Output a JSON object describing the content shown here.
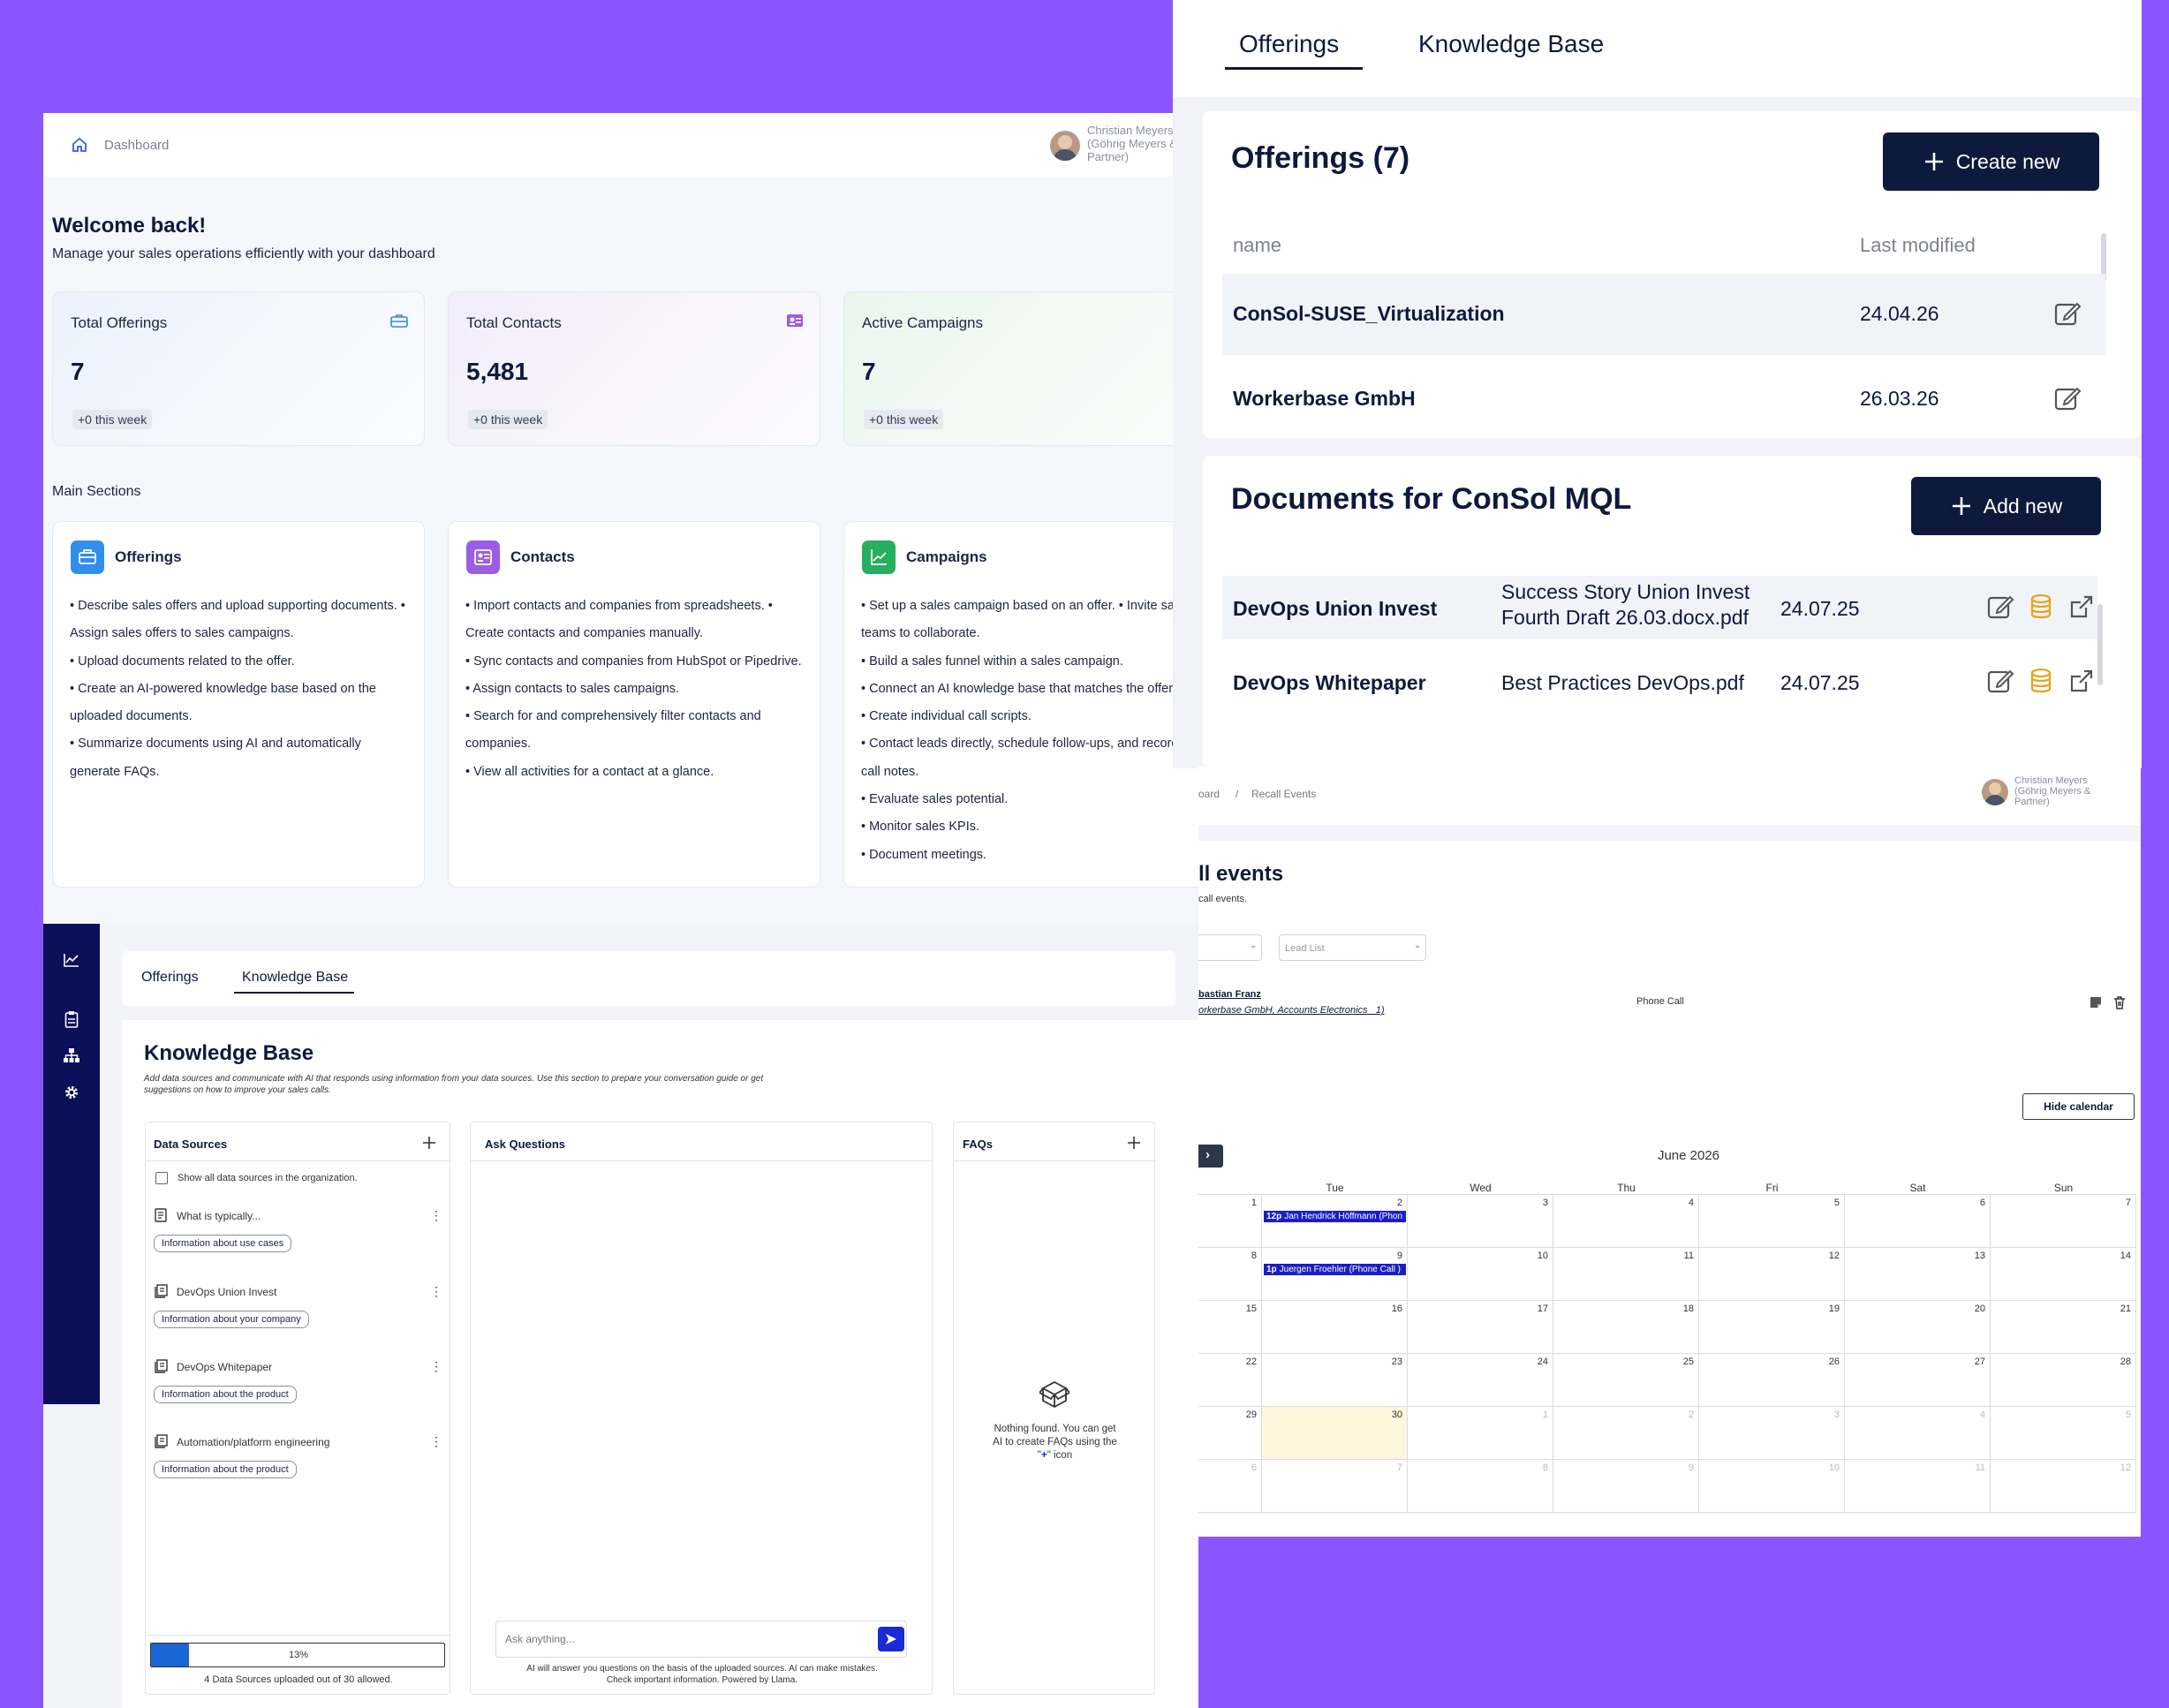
{
  "dashboard": {
    "breadcrumb": "Dashboard",
    "user": {
      "name_line1": "Christian Meyers",
      "name_line2": "(Göhrig Meyers &",
      "name_line3": "Partner)"
    },
    "welcome_title": "Welcome back!",
    "welcome_sub": "Manage your sales operations efficiently with your dashboard",
    "stats": [
      {
        "label": "Total Offerings",
        "value": "7",
        "delta": "+0 this week",
        "icon": "briefcase-icon",
        "color": "#3a86d8"
      },
      {
        "label": "Total Contacts",
        "value": "5,481",
        "delta": "+0 this week",
        "icon": "contact-card-icon",
        "color": "#9b5de5"
      },
      {
        "label": "Active Campaigns",
        "value": "7",
        "delta": "+0 this week",
        "icon": "trend-chart-icon",
        "color": "#2fa84f"
      }
    ],
    "main_sections_title": "Main Sections",
    "sections": [
      {
        "title": "Offerings",
        "icon": "briefcase-icon",
        "color": "#2f8fea",
        "lines": [
          "• Describe sales offers and upload supporting documents. •",
          "Assign sales offers to sales campaigns.",
          "• Upload documents related to the offer.",
          "• Create an AI-powered knowledge base based on the",
          "uploaded documents.",
          "• Summarize documents using AI and automatically",
          "generate FAQs."
        ]
      },
      {
        "title": "Contacts",
        "icon": "contact-card-icon",
        "color": "#9b5de5",
        "lines": [
          "• Import contacts and companies from spreadsheets. •",
          "Create contacts and companies manually.",
          "• Sync contacts and companies from HubSpot or Pipedrive.",
          "• Assign contacts to sales campaigns.",
          "• Search for and comprehensively filter contacts and",
          "companies.",
          "• View all activities for a contact at a glance."
        ]
      },
      {
        "title": "Campaigns",
        "icon": "trend-chart-icon",
        "color": "#27ae60",
        "lines": [
          "• Set up a sales campaign based on an offer. • Invite sales",
          "teams to collaborate.",
          "• Build a sales funnel within a sales campaign.",
          "• Connect an AI knowledge base that matches the offer.",
          "• Create individual call scripts.",
          "• Contact leads directly, schedule follow-ups, and record",
          "call notes.",
          "• Evaluate sales potential.",
          "• Monitor sales KPIs.",
          "• Document meetings."
        ]
      }
    ]
  },
  "offerings_panel": {
    "tabs": [
      "Offerings",
      "Knowledge Base"
    ],
    "title": "Offerings (7)",
    "create_btn": "Create new",
    "col_name": "name",
    "col_modified": "Last modified",
    "rows": [
      {
        "name": "ConSol-SUSE_Virtualization",
        "modified": "24.04.26"
      },
      {
        "name": "Workerbase GmbH",
        "modified": "26.03.26"
      }
    ],
    "docs_title": "Documents for ConSol MQL",
    "add_btn": "Add new",
    "docs": [
      {
        "name": "DevOps Union Invest",
        "file1": "Success Story Union Invest",
        "file2": "Fourth Draft 26.03.docx.pdf",
        "date": "24.07.25"
      },
      {
        "name": "DevOps Whitepaper",
        "file1": "Best Practices DevOps.pdf",
        "file2": "",
        "date": "24.07.25"
      }
    ]
  },
  "kb_panel": {
    "tabs": [
      "Offerings",
      "Knowledge Base"
    ],
    "title": "Knowledge Base",
    "desc_line1": "Add data sources and communicate with AI that responds using information from your data sources. Use this section to prepare your conversation guide or get",
    "desc_line2": "suggestions on how to improve your sales calls.",
    "data_sources_title": "Data Sources",
    "show_all_label": "Show all data sources in the organization.",
    "sources": [
      {
        "name": "What is typically...",
        "tag": "Information about use cases",
        "icon": "document-icon"
      },
      {
        "name": "DevOps Union Invest",
        "tag": "Information about your company",
        "icon": "file-stack-icon"
      },
      {
        "name": "DevOps Whitepaper",
        "tag": "Information about the product",
        "icon": "file-stack-icon"
      },
      {
        "name": "Automation/platform engineering",
        "tag": "Information about the product",
        "icon": "file-stack-icon"
      }
    ],
    "progress": 0.13,
    "progress_label": "13%",
    "upload_caption": "4 Data Sources uploaded out of 30 allowed.",
    "ask_title": "Ask Questions",
    "ask_placeholder": "Ask anything...",
    "ai_note_line1": "AI will answer you questions on the basis of the uploaded sources. AI can make mistakes.",
    "ai_note_line2": "Check important information. Powered by Llama.",
    "faqs_title": "FAQs",
    "faq_empty_line1": "Nothing found. You can get",
    "faq_empty_line2": "AI to create FAQs using the",
    "faq_empty_line3_pre": "\"",
    "faq_empty_line3_post": "\" icon"
  },
  "recall_panel": {
    "breadcrumb_prev": "oard",
    "breadcrumb_sep": "/",
    "breadcrumb_current": "Recall Events",
    "user": {
      "name_line1": "Christian Meyers",
      "name_line2": "(Göhrig Meyers &",
      "name_line3": "Partner)"
    },
    "title": "ll events",
    "subtitle": "call events.",
    "filter2_placeholder": "Lead List",
    "event": {
      "name": "bastian Franz",
      "company": "orkerbase GmbH, Accounts Electronics _1)",
      "type": "Phone Call"
    },
    "hide_calendar_btn": "Hide calendar",
    "month_label": "June 2026",
    "weekdays": [
      "",
      "Tue",
      "Wed",
      "Thu",
      "Fri",
      "Sat",
      "Sun"
    ],
    "weeks": [
      [
        "1",
        "2",
        "3",
        "4",
        "5",
        "6",
        "7"
      ],
      [
        "8",
        "9",
        "10",
        "11",
        "12",
        "13",
        "14"
      ],
      [
        "15",
        "16",
        "17",
        "18",
        "19",
        "20",
        "21"
      ],
      [
        "22",
        "23",
        "24",
        "25",
        "26",
        "27",
        "28"
      ],
      [
        "29",
        "30",
        "1",
        "2",
        "3",
        "4",
        "5"
      ],
      [
        "6",
        "7",
        "8",
        "9",
        "10",
        "11",
        "12"
      ]
    ],
    "calendar_events": [
      {
        "week": 0,
        "day": 1,
        "time": "12p",
        "label": "Jan Hendrick Höffmann (Phon"
      },
      {
        "week": 1,
        "day": 1,
        "time": "1p",
        "label": "Juergen Froehler (Phone Call )"
      }
    ]
  },
  "sidebar_icons": [
    "line-chart-icon",
    "clipboard-icon",
    "org-chart-icon",
    "gear-icon"
  ]
}
